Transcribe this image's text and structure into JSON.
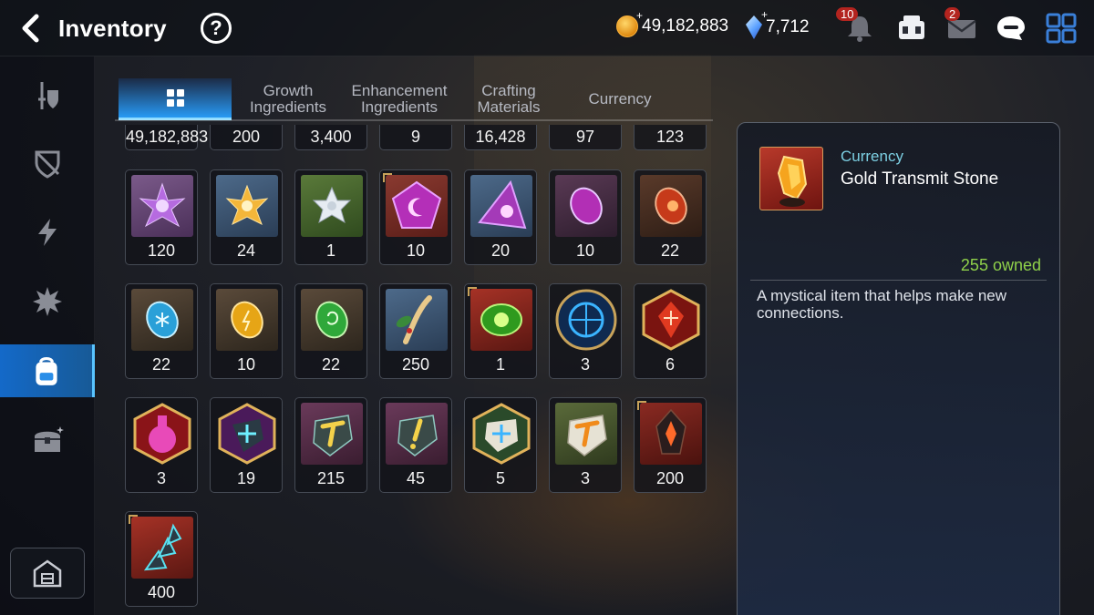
{
  "header": {
    "title": "Inventory",
    "help_label": "?",
    "gold": "49,182,883",
    "crystals": "7,712",
    "notifications_count": "10",
    "mail_count": "2"
  },
  "tabs": [
    {
      "label": "",
      "icon": "grid-icon",
      "active": true
    },
    {
      "label": "Growth\nIngredients"
    },
    {
      "label": "Enhancement\nIngredients"
    },
    {
      "label": "Crafting\nMaterials"
    },
    {
      "label": "Currency"
    }
  ],
  "items": {
    "row0": [
      "49,182,883",
      "200",
      "3,400",
      "9",
      "16,428",
      "97",
      "123"
    ],
    "row1": [
      "120",
      "24",
      "1",
      "10",
      "20",
      "10",
      "22"
    ],
    "row2": [
      "22",
      "10",
      "22",
      "250",
      "1",
      "3",
      "6"
    ],
    "row3": [
      "3",
      "19",
      "215",
      "45",
      "5",
      "3",
      "200"
    ],
    "row4": [
      "400"
    ]
  },
  "detail": {
    "category": "Currency",
    "name": "Gold Transmit Stone",
    "owned": "255 owned",
    "description": "A mystical item that helps make new connections."
  },
  "colors": {
    "accent": "#1e96ff",
    "owned_green": "#8fd14a",
    "category_cyan": "#7ccfe2",
    "frame_gold": "#c8a35a"
  }
}
